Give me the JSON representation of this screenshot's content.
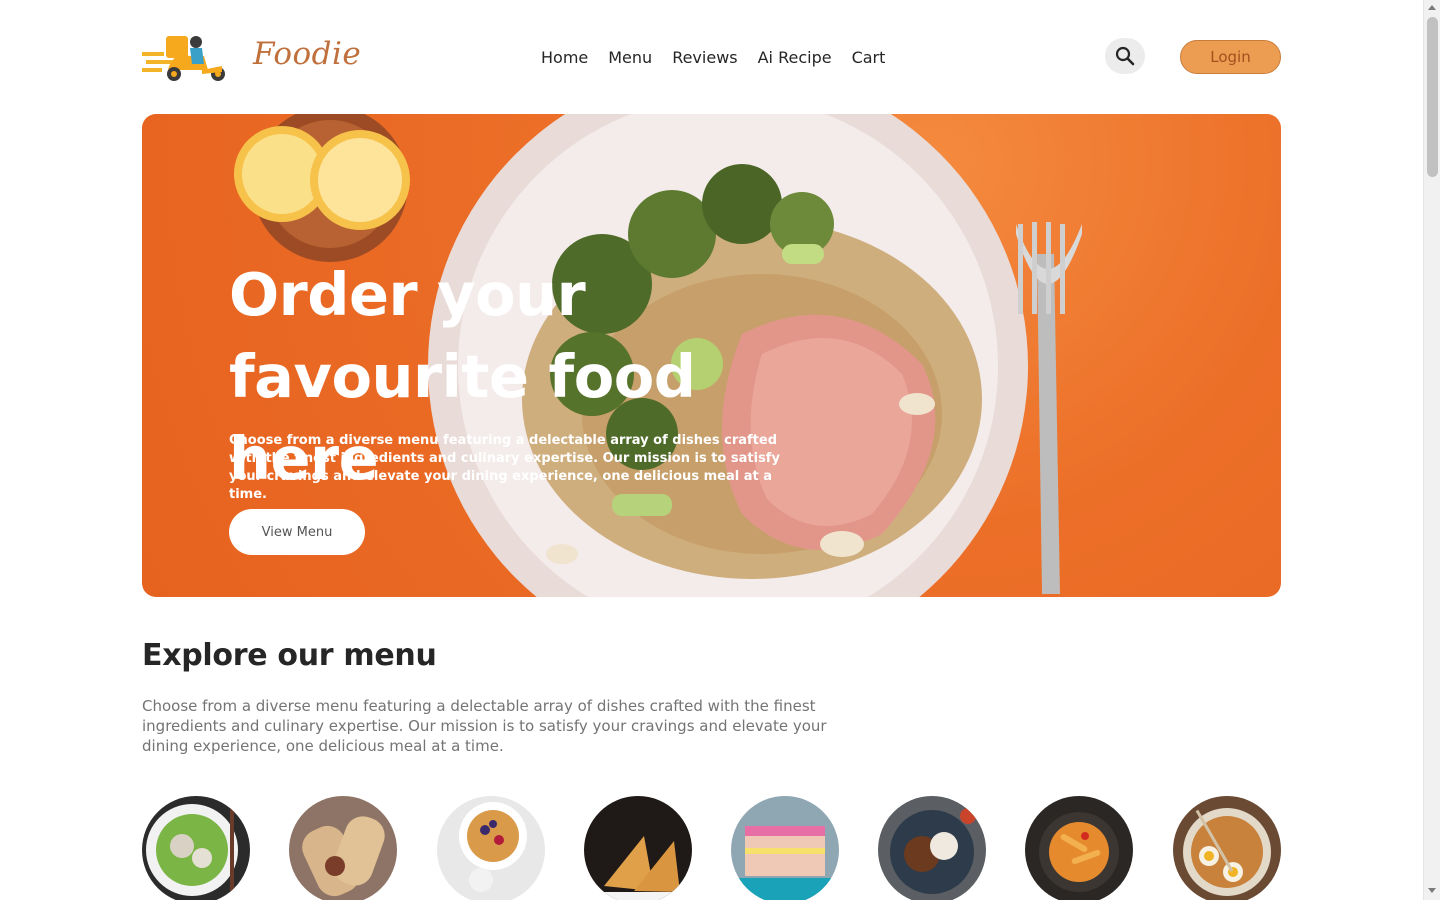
{
  "header": {
    "brand": "Foodie",
    "nav": [
      "Home",
      "Menu",
      "Reviews",
      "Ai Recipe",
      "Cart"
    ],
    "login_label": "Login"
  },
  "hero": {
    "title_line1": "Order your",
    "title_line2": "favourite food here",
    "description": "Choose from a diverse menu featuring a delectable array of dishes crafted with the finest ingredients and culinary expertise. Our mission is to satisfy your cravings and elevate your dining experience, one delicious meal at a time.",
    "button_label": "View Menu"
  },
  "explore": {
    "title": "Explore our menu",
    "description": "Choose from a diverse menu featuring a delectable array of dishes crafted with the finest ingredients and culinary expertise. Our mission is to satisfy your cravings and elevate your dining experience, one delicious meal at a time."
  },
  "menu_items": [
    "salad-image",
    "rolls-image",
    "dessert-image",
    "sandwich-image",
    "cake-image",
    "pure-veg-image",
    "pasta-image",
    "noodles-image"
  ],
  "colors": {
    "accent": "#ec9d52",
    "hero_bg": "#ec6f28",
    "brand_text": "#c0703c"
  }
}
